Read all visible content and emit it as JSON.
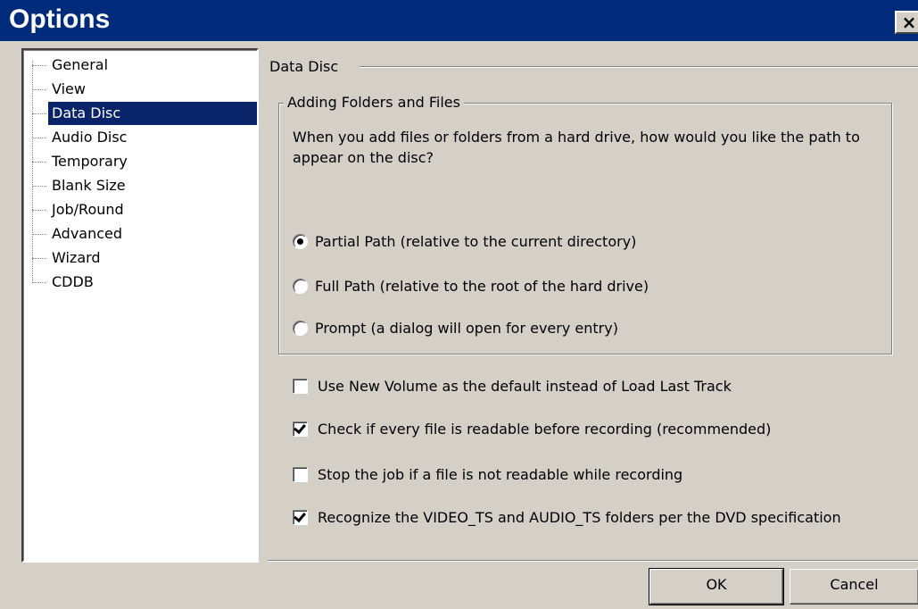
{
  "window": {
    "title": "Options",
    "close_symbol": "×"
  },
  "tree": {
    "items": [
      {
        "label": "General"
      },
      {
        "label": "View"
      },
      {
        "label": "Data Disc",
        "selected": true
      },
      {
        "label": "Audio Disc"
      },
      {
        "label": "Temporary"
      },
      {
        "label": "Blank Size"
      },
      {
        "label": "Job/Round"
      },
      {
        "label": "Advanced"
      },
      {
        "label": "Wizard"
      },
      {
        "label": "CDDB"
      }
    ]
  },
  "panel": {
    "section_title": "Data Disc",
    "group": {
      "title": "Adding Folders and Files",
      "description": "When you add files or folders from a hard drive, how would you like the path to appear on the disc?",
      "options": [
        {
          "label": "Partial Path (relative to the current directory)",
          "checked": true
        },
        {
          "label": "Full Path (relative to the root of the hard drive)",
          "checked": false
        },
        {
          "label": "Prompt (a dialog will open for every entry)",
          "checked": false
        }
      ]
    },
    "checkboxes": [
      {
        "label": "Use New Volume as the default instead of Load Last Track",
        "checked": false
      },
      {
        "label": "Check if every file is readable before recording (recommended)",
        "checked": true
      },
      {
        "label": "Stop the job if a file is not readable while recording",
        "checked": false
      },
      {
        "label": "Recognize the VIDEO_TS and AUDIO_TS folders per the DVD specification",
        "checked": true
      }
    ]
  },
  "buttons": {
    "ok": "OK",
    "cancel": "Cancel"
  }
}
